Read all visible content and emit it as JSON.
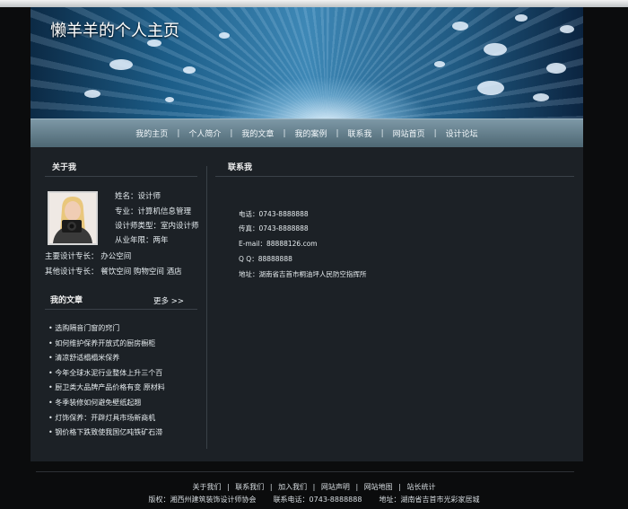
{
  "site": {
    "title": "懒羊羊的个人主页"
  },
  "nav": {
    "items": [
      "我的主页",
      "个人简介",
      "我的文章",
      "我的案例",
      "联系我",
      "网站首页",
      "设计论坛"
    ],
    "separator": "|"
  },
  "about": {
    "heading": "关于我",
    "name": "姓名：设计师",
    "major": "专业：计算机信息管理",
    "designer_type": "设计师类型：室内设计师",
    "experience": "从业年限：两年",
    "main_skill": "主要设计专长：  办公空间",
    "other_skill": "其他设计专长：  餐饮空间  购物空间  酒店"
  },
  "articles": {
    "heading": "我的文章",
    "more_label": "更多 >>",
    "items": [
      "• 选购隔音门窗的窍门",
      "• 如何维护保养开放式的厨房橱柜",
      "• 清凉舒适榻榻米保养",
      "• 今年全球水泥行业整体上升三个百",
      "• 厨卫类大品牌产品价格有变 原材料",
      "• 冬季装修如何避免壁纸起翘",
      "• 灯饰保养：开辟灯具市场新商机",
      "• 钢价格下跌致使我国亿吨铁矿石滞"
    ]
  },
  "contact": {
    "heading": "联系我",
    "phone": "电话：0743-8888888",
    "fax": "传真：0743-8888888",
    "email": "E-mail：88888126.com",
    "qq": "Q  Q：88888888",
    "address": "地址：湖南省吉首市桐油坪人民防空指挥所"
  },
  "footer": {
    "links": [
      "关于我们",
      "联系我们",
      "加入我们",
      "网站声明",
      "网站地图",
      "站长统计"
    ],
    "link_separator": "|",
    "copyright": "版权：湘西州建筑装饰设计师协会",
    "phone": "联系电话：0743-8888888",
    "address": "地址：湖南省吉首市光彩家居城"
  }
}
